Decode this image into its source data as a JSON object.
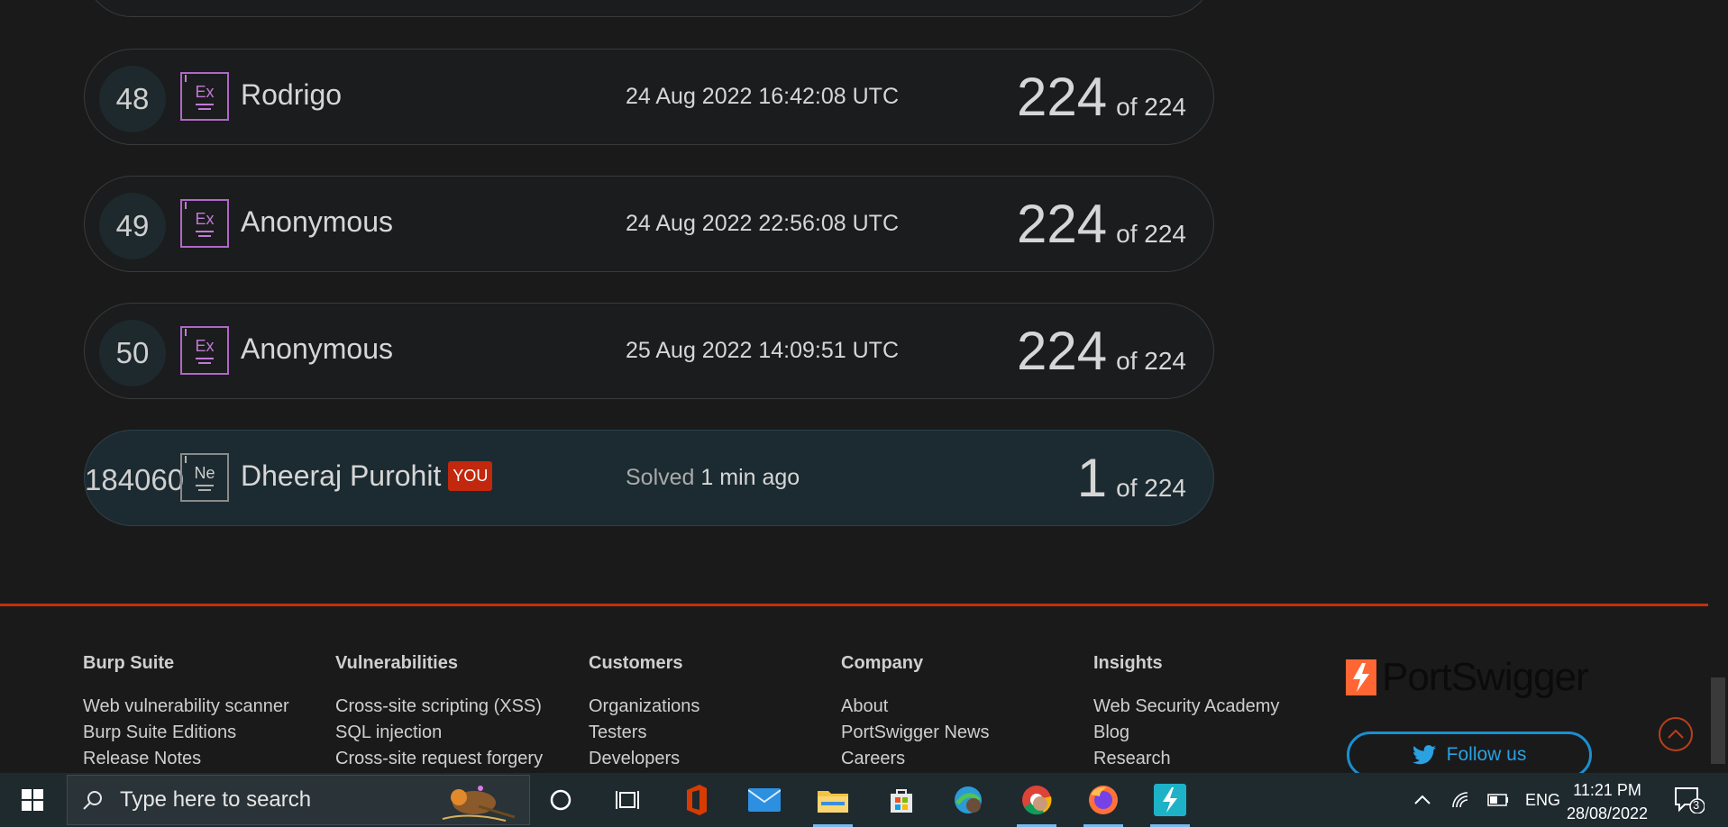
{
  "leaderboard": {
    "rows": [
      {
        "rank": "48",
        "badge": "Ex",
        "name": "Rodrigo",
        "date": "24 Aug 2022 16:42:08 UTC",
        "score": "224",
        "of": "of 224"
      },
      {
        "rank": "49",
        "badge": "Ex",
        "name": "Anonymous",
        "date": "24 Aug 2022 22:56:08 UTC",
        "score": "224",
        "of": "of 224"
      },
      {
        "rank": "50",
        "badge": "Ex",
        "name": "Anonymous",
        "date": "25 Aug 2022 14:09:51 UTC",
        "score": "224",
        "of": "of 224"
      }
    ],
    "you_row": {
      "rank": "184060",
      "badge": "Ne",
      "name": "Dheeraj Purohit",
      "you_tag": "YOU",
      "solved_label": "Solved",
      "solved_time": "1 min ago",
      "score": "1",
      "of": "of 224"
    }
  },
  "footer": {
    "columns": [
      {
        "heading": "Burp Suite",
        "links": [
          "Web vulnerability scanner",
          "Burp Suite Editions",
          "Release Notes"
        ]
      },
      {
        "heading": "Vulnerabilities",
        "links": [
          "Cross-site scripting (XSS)",
          "SQL injection",
          "Cross-site request forgery"
        ]
      },
      {
        "heading": "Customers",
        "links": [
          "Organizations",
          "Testers",
          "Developers"
        ]
      },
      {
        "heading": "Company",
        "links": [
          "About",
          "PortSwigger News",
          "Careers"
        ]
      },
      {
        "heading": "Insights",
        "links": [
          "Web Security Academy",
          "Blog",
          "Research"
        ]
      }
    ],
    "logo_text": "PortSwigger",
    "follow_label": "Follow us"
  },
  "taskbar": {
    "search_placeholder": "Type here to search",
    "language": "ENG",
    "time": "11:21 PM",
    "date": "28/08/2022",
    "notifications": "3"
  },
  "colors": {
    "accent": "#c3300d",
    "badge_ex": "#b067c7",
    "twitter": "#1a8fd0",
    "logo_orange": "#ff6633"
  }
}
